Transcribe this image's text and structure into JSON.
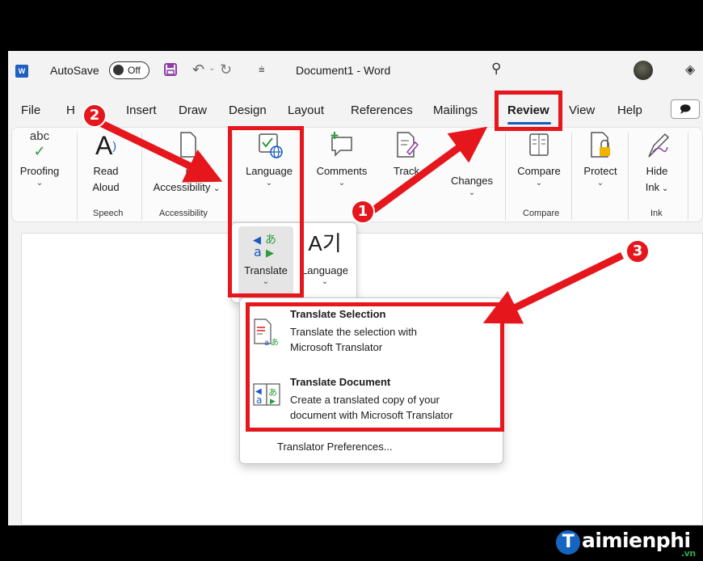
{
  "titlebar": {
    "app_icon_letter": "W",
    "autosave_label": "AutoSave",
    "autosave_state": "Off",
    "document_title": "Document1  -  Word",
    "qat_more": "⩧"
  },
  "tabs": [
    {
      "label": "File"
    },
    {
      "label": "H"
    },
    {
      "label": "Insert"
    },
    {
      "label": "Draw"
    },
    {
      "label": "Design"
    },
    {
      "label": "Layout"
    },
    {
      "label": "References"
    },
    {
      "label": "Mailings"
    },
    {
      "label": "Review",
      "active": true
    },
    {
      "label": "View"
    },
    {
      "label": "Help"
    }
  ],
  "ribbon": {
    "proofing": {
      "icon_text": "abc",
      "label": "Proofing"
    },
    "read_aloud": {
      "label_line1": "Read",
      "label_line2": "Aloud",
      "group": "Speech"
    },
    "check_accessibility": {
      "label_partial": "Ch",
      "label_line2": "Accessibility",
      "group": "Accessibility"
    },
    "language": {
      "label": "Language"
    },
    "comments": {
      "label": "Comments"
    },
    "tracking": {
      "label": "Track"
    },
    "changes": {
      "label": "Changes"
    },
    "compare": {
      "label": "Compare",
      "group": "Compare"
    },
    "protect": {
      "label": "Protect"
    },
    "hide_ink": {
      "label_line1": "Hide",
      "label_line2": "Ink",
      "group": "Ink"
    }
  },
  "language_flyout": {
    "translate_label": "Translate",
    "language_label": "Language",
    "language_icon_text": "A기"
  },
  "translate_menu": {
    "items": [
      {
        "title": "Translate Selection",
        "underline_char": "S",
        "desc_line1": "Translate the selection with",
        "desc_line2": "Microsoft Translator"
      },
      {
        "title": "Translate Document",
        "underline_char": "T",
        "desc_line1": "Create a translated copy of your",
        "desc_line2": "document with Microsoft Translator"
      }
    ],
    "footer": "Translator Preferences..."
  },
  "annotations": {
    "badges": [
      "1",
      "2",
      "3"
    ],
    "color": "#e5161c"
  },
  "watermark": {
    "brand_t": "T",
    "brand_rest": "aimienphi",
    "suffix": ".vn"
  }
}
